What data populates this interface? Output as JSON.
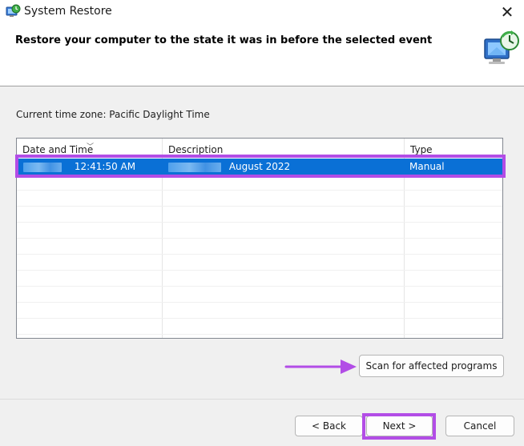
{
  "window": {
    "title": "System Restore",
    "close_glyph": "✕"
  },
  "header": {
    "heading": "Restore your computer to the state it was in before the selected event"
  },
  "timezone": {
    "label": "Current time zone: Pacific Daylight Time"
  },
  "restore_list": {
    "columns": [
      "Date and Time",
      "Description",
      "Type"
    ],
    "sort_indicator": "﹀",
    "rows": [
      {
        "date_time": "12:41:50 AM",
        "description": "August 2022",
        "type": "Manual",
        "selected": true
      }
    ],
    "empty_row_count": 10
  },
  "buttons": {
    "scan": "Scan for affected programs",
    "back": "< Back",
    "next": "Next >",
    "cancel": "Cancel"
  },
  "annotations": {
    "highlight_color": "#b24de6"
  },
  "colors": {
    "selection": "#0a70d6",
    "content_bg": "#f0f0f0"
  }
}
